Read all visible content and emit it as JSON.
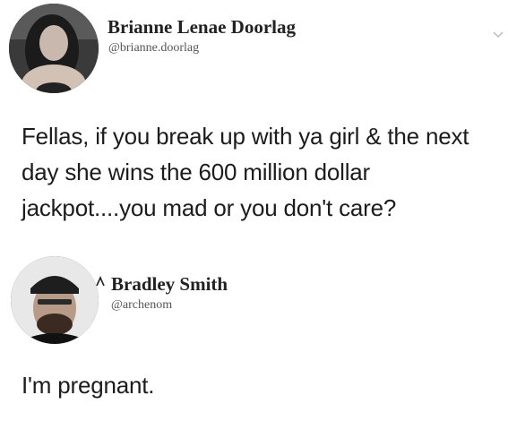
{
  "tweet": {
    "author": {
      "name": "Brianne Lenae Doorlag",
      "handle": "@brianne.doorlag",
      "avatar_icon": "profile-photo-woman"
    },
    "text": "Fellas, if you break up with ya girl & the next day she wins the 600 million dollar jackpot....you mad or you don't care?",
    "menu_icon": "chevron-down-icon"
  },
  "reply": {
    "author": {
      "name": "Bradley Smith",
      "handle": "@archenom",
      "avatar_icon": "profile-photo-man"
    },
    "text": "I'm pregnant.",
    "reply_icon": "reply-arrow-icon"
  },
  "colors": {
    "background": "#ffffff",
    "text": "#1c1c1c",
    "handle": "#555555"
  }
}
